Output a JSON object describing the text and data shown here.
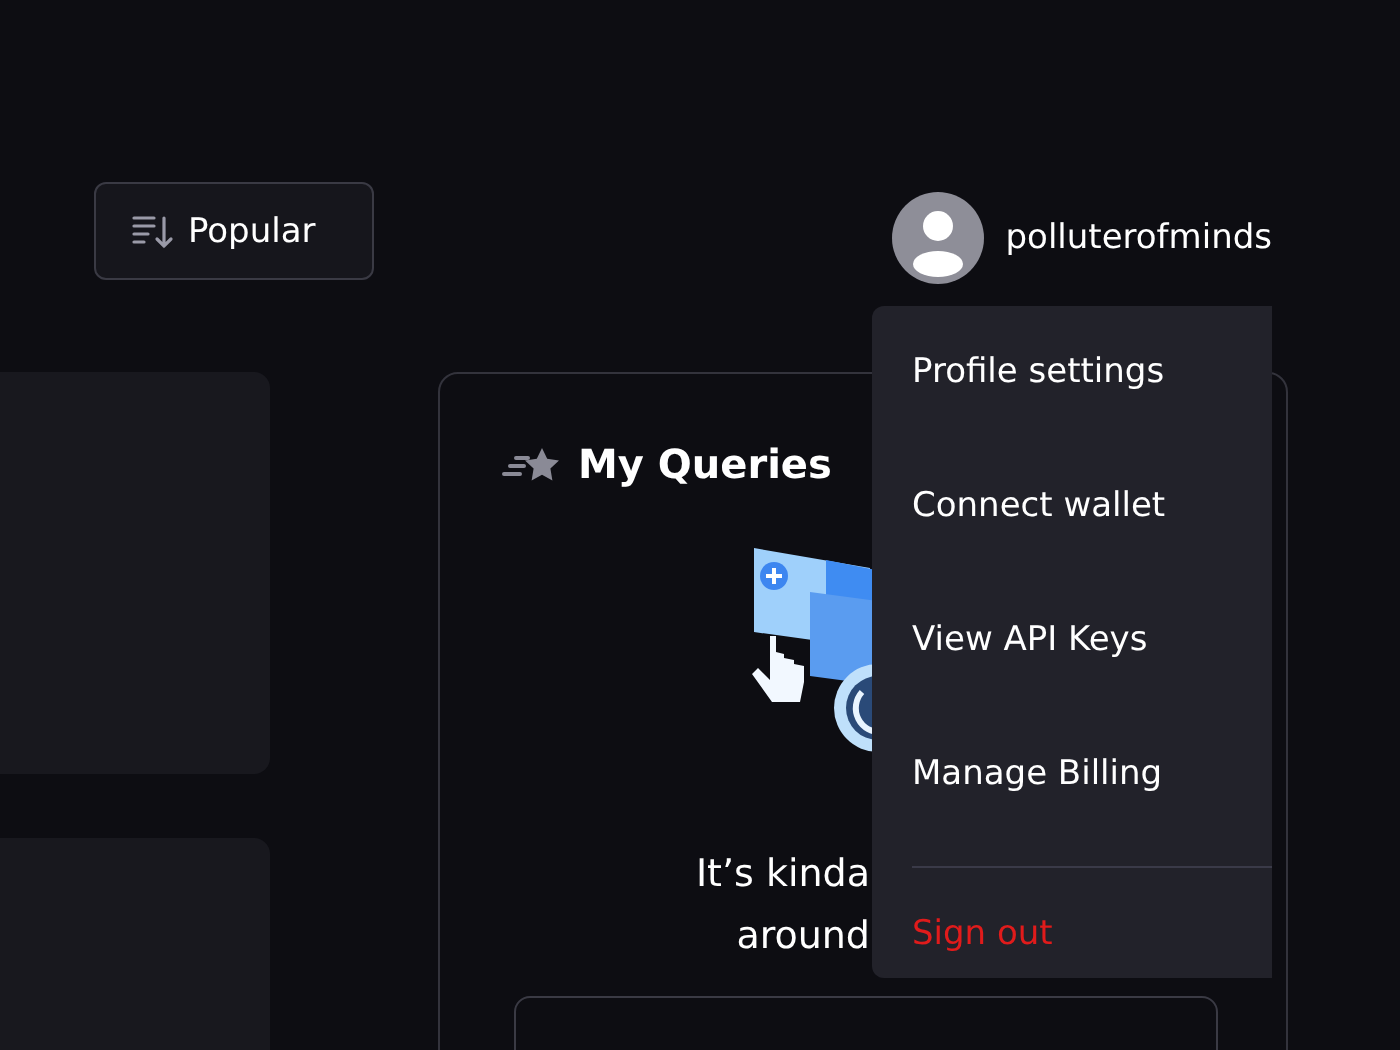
{
  "sort_button": {
    "label": "Popular"
  },
  "user": {
    "name": "polluterofminds"
  },
  "queries_card": {
    "title": "My Queries",
    "message_lines": [
      "It’s kinda",
      "around"
    ]
  },
  "user_menu": {
    "items": [
      {
        "label": "Profile settings",
        "kind": "normal"
      },
      {
        "label": "Connect wallet",
        "kind": "normal"
      },
      {
        "label": "View API Keys",
        "kind": "normal"
      },
      {
        "label": "Manage Billing",
        "kind": "normal"
      },
      {
        "label": "Sign out",
        "kind": "danger"
      }
    ]
  }
}
